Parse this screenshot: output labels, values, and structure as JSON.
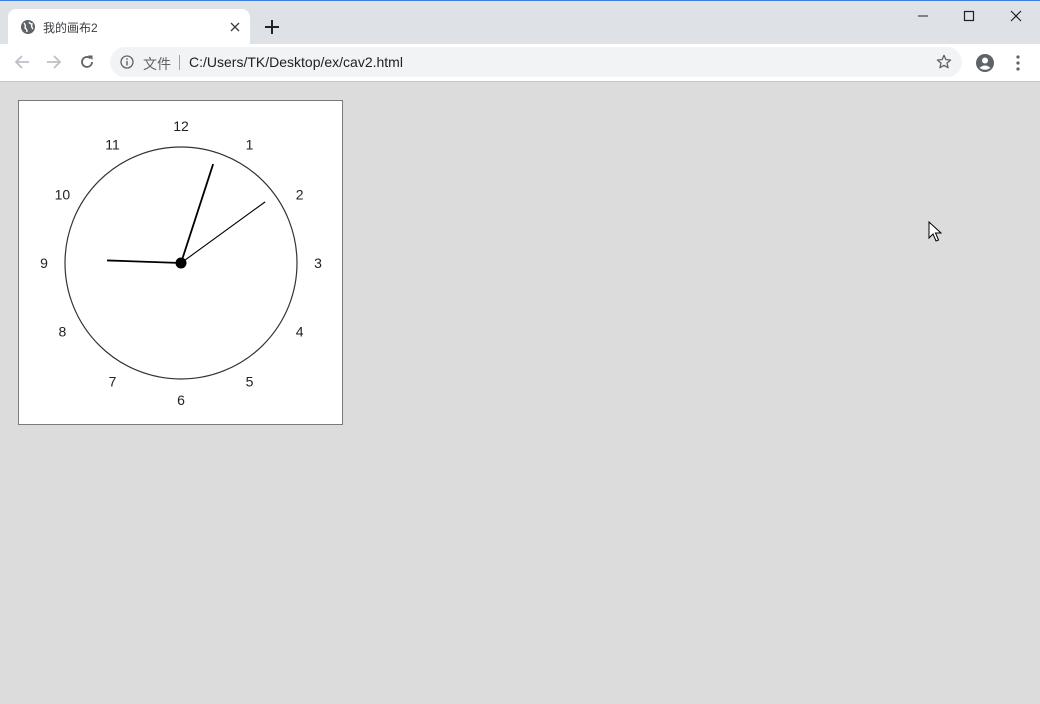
{
  "tab": {
    "title": "我的画布2",
    "favicon": "globe-icon",
    "close": "close-icon"
  },
  "newtab": {
    "icon": "plus-icon"
  },
  "window_controls": [
    "minimize-icon",
    "maximize-icon",
    "close-icon"
  ],
  "toolbar": {
    "back": "arrow-left-icon",
    "forward": "arrow-right-icon",
    "reload": "reload-icon",
    "security_label": "文件",
    "url": "C:/Users/TK/Desktop/ex/cav2.html",
    "bookmark": "star-icon",
    "profile": "account-icon",
    "menu": "kebab-menu-icon"
  },
  "clock": {
    "numerals": [
      "12",
      "1",
      "2",
      "3",
      "4",
      "5",
      "6",
      "7",
      "8",
      "9",
      "10",
      "11"
    ],
    "time": {
      "hour": 1.3,
      "minute": 1.6,
      "second": 10.5
    },
    "face_color": "#ffffff",
    "stroke_color": "#333333",
    "hand_color": "#000000"
  },
  "colors": {
    "page_bg": "#dcdcdc",
    "tabstrip_bg": "#dee1e6",
    "accent": "#3b7fd9"
  }
}
